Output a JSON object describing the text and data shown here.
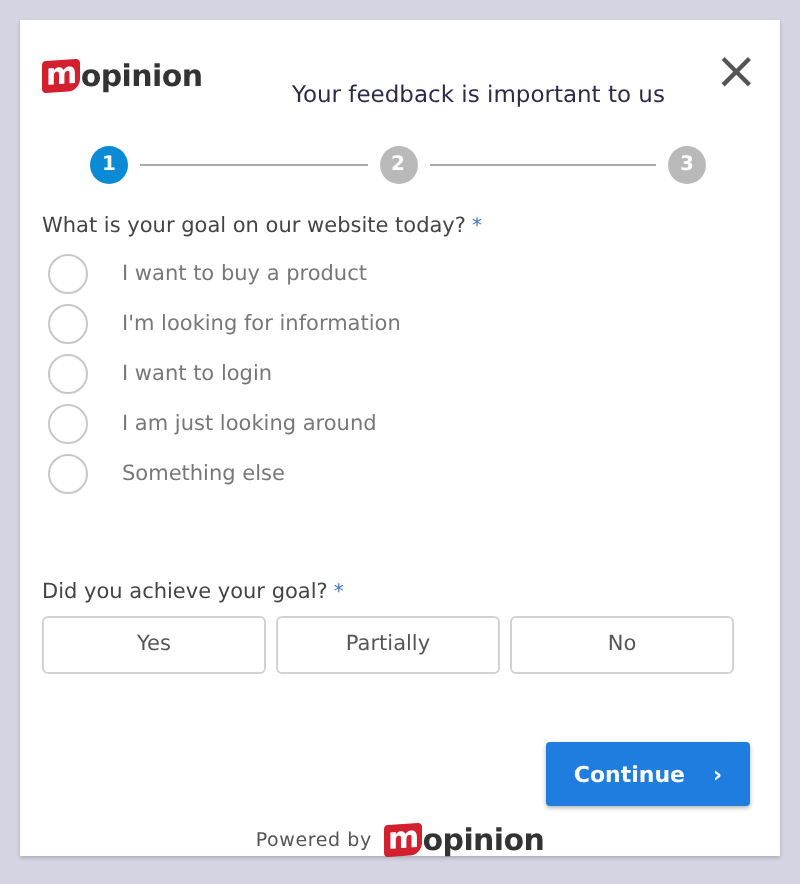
{
  "header": {
    "logo": {
      "mark": "m",
      "rest": "opinion"
    },
    "title": "Your feedback is important to us",
    "close": "×"
  },
  "steps": [
    {
      "label": "1",
      "selected": true
    },
    {
      "label": "2",
      "selected": false
    },
    {
      "label": "3",
      "selected": false
    }
  ],
  "question_1": {
    "label": "What is your goal on our website today?",
    "required": "*",
    "options": [
      {
        "label": "I want to buy a product",
        "selected": false
      },
      {
        "label": "I'm looking for information",
        "selected": false
      },
      {
        "label": "I want to login",
        "selected": false
      },
      {
        "label": "I am just looking around",
        "selected": false
      },
      {
        "label": "Something else",
        "selected": false
      }
    ]
  },
  "question_2": {
    "label": "Did you achieve your goal?",
    "required": "*",
    "options": [
      {
        "label": "Yes",
        "selected": false
      },
      {
        "label": "Partially",
        "selected": false
      },
      {
        "label": "No",
        "selected": false
      }
    ]
  },
  "continue_button": {
    "label": "Continue",
    "arrow": "›"
  },
  "footer": {
    "powered_by": "Powered by",
    "logo": {
      "mark": "m",
      "rest": "opinion"
    }
  }
}
